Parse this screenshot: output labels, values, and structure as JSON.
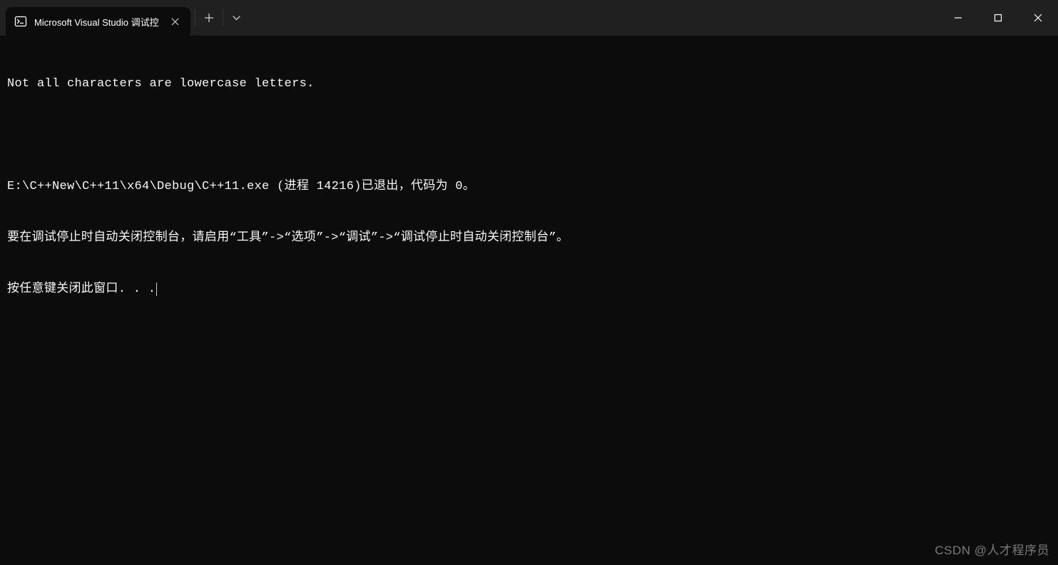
{
  "titlebar": {
    "tab": {
      "title": "Microsoft Visual Studio 调试控"
    }
  },
  "console": {
    "lines": [
      "Not all characters are lowercase letters.",
      "",
      "E:\\C++New\\C++11\\x64\\Debug\\C++11.exe (进程 14216)已退出，代码为 0。",
      "要在调试停止时自动关闭控制台，请启用“工具”->“选项”->“调试”->“调试停止时自动关闭控制台”。",
      "按任意键关闭此窗口. . ."
    ]
  },
  "watermark": "CSDN @人才程序员"
}
